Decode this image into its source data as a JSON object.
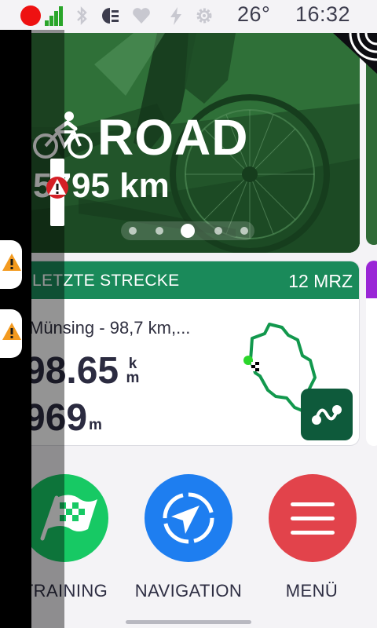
{
  "status_bar": {
    "temperature": "26°",
    "time": "16:32",
    "icons": [
      "recording-dot",
      "signal-bars",
      "bluetooth-icon",
      "headlight-icon",
      "heart-icon",
      "bolt-icon",
      "gear-icon"
    ]
  },
  "hero": {
    "title": "ROAD",
    "distance": "5795 km",
    "distance_visible": "795 km",
    "page_count": 5,
    "active_page": 3
  },
  "route_card": {
    "title": "LETZTE STRECKE",
    "title_visible": "ETZTE STRECKE",
    "date": "12 MRZ",
    "name": "Münsing - 98,7 km,...",
    "distance_value": "98.65",
    "distance_unit_top": "k",
    "distance_unit_bottom": "m",
    "elevation_value": "969",
    "elevation_unit": "m"
  },
  "actions": [
    {
      "label": "TRAINING",
      "color": "#17c964",
      "icon": "checkered-flag-icon"
    },
    {
      "label": "NAVIGATION",
      "color": "#1e7ef0",
      "icon": "compass-arrow-icon"
    },
    {
      "label": "MENÜ",
      "color": "#e2434b",
      "icon": "menu-icon"
    }
  ],
  "colors": {
    "route_header": "#1a8a5a",
    "next_card_header": "#9a26d6",
    "hero_tint": "#24592d"
  }
}
